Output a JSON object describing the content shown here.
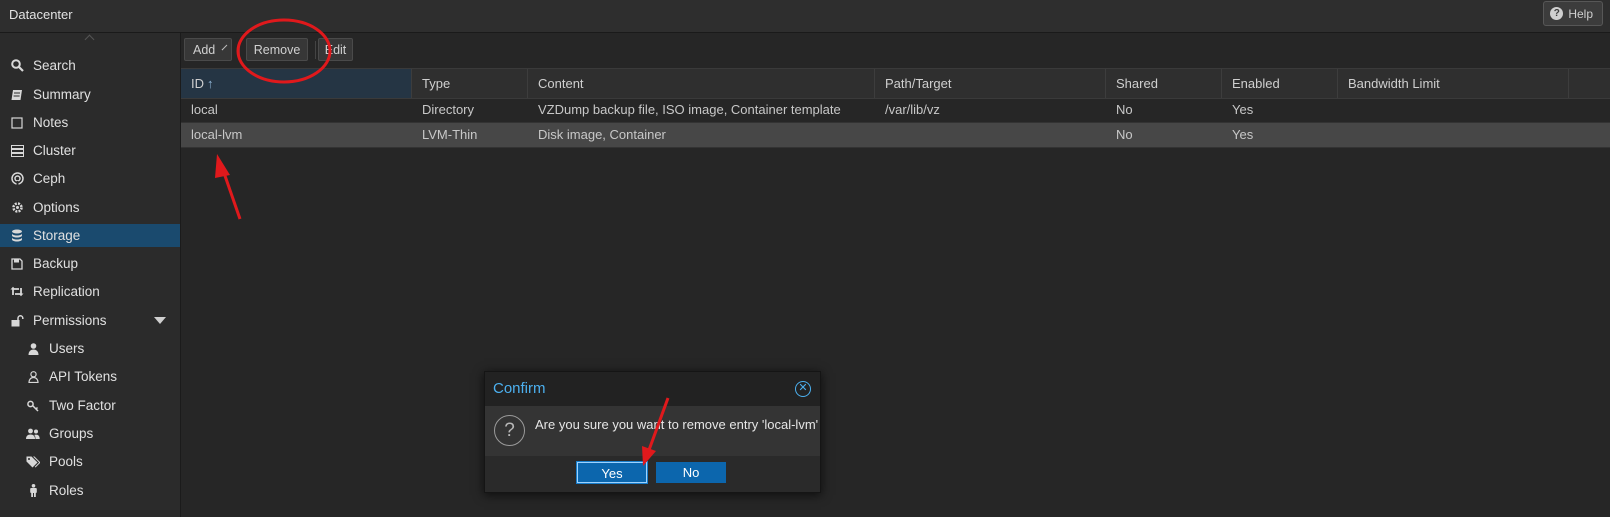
{
  "header": {
    "title": "Datacenter",
    "help_label": "Help"
  },
  "sidebar": {
    "items": [
      {
        "label": "Search",
        "icon": "search-icon"
      },
      {
        "label": "Summary",
        "icon": "book-icon"
      },
      {
        "label": "Notes",
        "icon": "note-icon"
      },
      {
        "label": "Cluster",
        "icon": "server-icon"
      },
      {
        "label": "Ceph",
        "icon": "ceph-icon"
      },
      {
        "label": "Options",
        "icon": "gear-icon"
      },
      {
        "label": "Storage",
        "icon": "database-icon",
        "active": true
      },
      {
        "label": "Backup",
        "icon": "floppy-icon"
      },
      {
        "label": "Replication",
        "icon": "retweet-icon"
      },
      {
        "label": "Permissions",
        "icon": "unlock-icon"
      },
      {
        "label": "Users",
        "icon": "user-icon"
      },
      {
        "label": "API Tokens",
        "icon": "user-outline-icon"
      },
      {
        "label": "Two Factor",
        "icon": "key-icon"
      },
      {
        "label": "Groups",
        "icon": "users-icon"
      },
      {
        "label": "Pools",
        "icon": "tags-icon"
      },
      {
        "label": "Roles",
        "icon": "male-icon"
      }
    ]
  },
  "toolbar": {
    "add_label": "Add",
    "remove_label": "Remove",
    "edit_label": "Edit"
  },
  "table": {
    "columns": [
      "ID",
      "Type",
      "Content",
      "Path/Target",
      "Shared",
      "Enabled",
      "Bandwidth Limit"
    ],
    "sort_arrow": "↑",
    "rows": [
      [
        "local",
        "Directory",
        "VZDump backup file, ISO image, Container template",
        "/var/lib/vz",
        "No",
        "Yes",
        ""
      ],
      [
        "local-lvm",
        "LVM-Thin",
        "Disk image, Container",
        "",
        "No",
        "Yes",
        ""
      ]
    ],
    "selected_row": 1
  },
  "dialog": {
    "title": "Confirm",
    "message": "Are you sure you want to remove entry 'local-lvm'",
    "yes_label": "Yes",
    "no_label": "No",
    "question_glyph": "?"
  },
  "colors": {
    "accent": "#0c66ad",
    "active_nav": "#1a4a6e",
    "annotation": "#e0191c",
    "dialog_title": "#4cb0ef"
  }
}
